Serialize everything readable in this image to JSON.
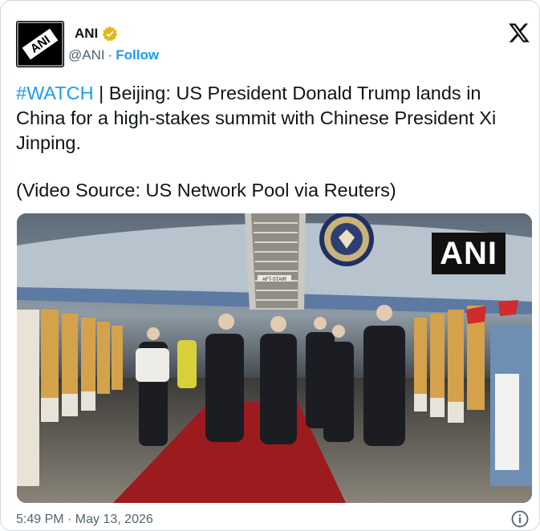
{
  "author": {
    "name": "ANI",
    "handle": "@ANI",
    "separator": "·",
    "follow_label": "Follow",
    "avatar_text": "ANI",
    "verified_icon": "verified-gold-badge-icon"
  },
  "header": {
    "platform_icon": "x-logo-icon"
  },
  "tweet": {
    "hashtag": "#WATCH",
    "body": " | Beijing: US President Donald Trump lands in China for a high-stakes summit with Chinese President Xi Jinping.",
    "source": "(Video Source: US Network Pool via Reuters)"
  },
  "media": {
    "watermark": "ANI",
    "kind": "video-still",
    "stair_label": "AFT-STAIR"
  },
  "footer": {
    "timestamp": "5:49 PM · May 13, 2026",
    "info_icon": "info-circle-icon"
  },
  "colors": {
    "link": "#1d9bf0",
    "secondary_text": "#536471",
    "verified_gold": "#e2b719",
    "carpet": "#9b1b1f"
  }
}
